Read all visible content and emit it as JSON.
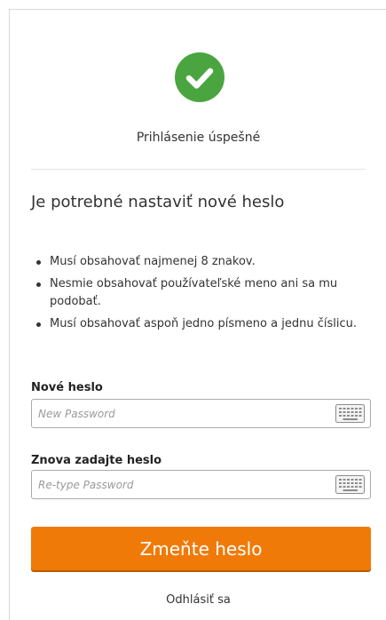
{
  "status": {
    "message": "Prihlásenie úspešné",
    "icon": "check-circle-icon",
    "color": "#4aa540"
  },
  "heading": "Je potrebné nastaviť nové heslo",
  "requirements": [
    "Musí obsahovať najmenej 8 znakov.",
    "Nesmie obsahovať používateľské meno ani sa mu podobať.",
    "Musí obsahovať aspoň jedno písmeno a jednu číslicu."
  ],
  "new_password": {
    "label": "Nové heslo",
    "placeholder": "New Password",
    "value": "",
    "icon": "keyboard-icon"
  },
  "confirm_password": {
    "label": "Znova zadajte heslo",
    "placeholder": "Re-type Password",
    "value": "",
    "icon": "keyboard-icon"
  },
  "submit": {
    "label": "Zmeňte heslo",
    "color": "#f07a08"
  },
  "logout": {
    "label": "Odhlásiť sa"
  }
}
